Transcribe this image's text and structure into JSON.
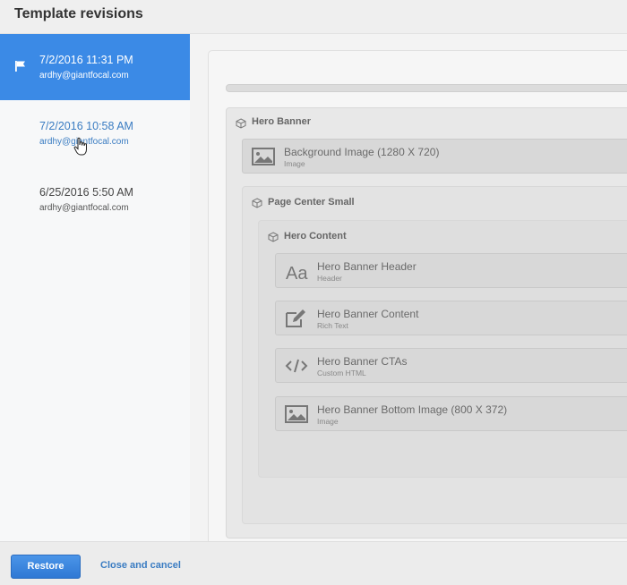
{
  "header": {
    "title": "Template revisions"
  },
  "revisions": [
    {
      "date": "7/2/2016 11:31 PM",
      "email": "ardhy@giantfocal.com",
      "selected": true
    },
    {
      "date": "7/2/2016 10:58 AM",
      "email": "ardhy@giantfocal.com",
      "hovered": true
    },
    {
      "date": "6/25/2016 5:50 AM",
      "email": "ardhy@giantfocal.com"
    }
  ],
  "preview": {
    "hero_banner": {
      "title": "Hero Banner"
    },
    "background_image": {
      "title": "Background Image (1280 X 720)",
      "type": "Image"
    },
    "page_center": {
      "title": "Page Center Small"
    },
    "hero_content": {
      "title": "Hero Content"
    },
    "blocks": [
      {
        "title": "Hero Banner Header",
        "type": "Header",
        "icon": "text-icon"
      },
      {
        "title": "Hero Banner Content",
        "type": "Rich Text",
        "icon": "edit-icon"
      },
      {
        "title": "Hero Banner CTAs",
        "type": "Custom HTML",
        "icon": "code-icon"
      },
      {
        "title": "Hero Banner Bottom Image (800 X 372)",
        "type": "Image",
        "icon": "image-icon"
      }
    ]
  },
  "footer": {
    "restore_label": "Restore",
    "cancel_label": "Close and cancel"
  },
  "colors": {
    "accent": "#3b8ae6",
    "link": "#3a7cc2"
  }
}
